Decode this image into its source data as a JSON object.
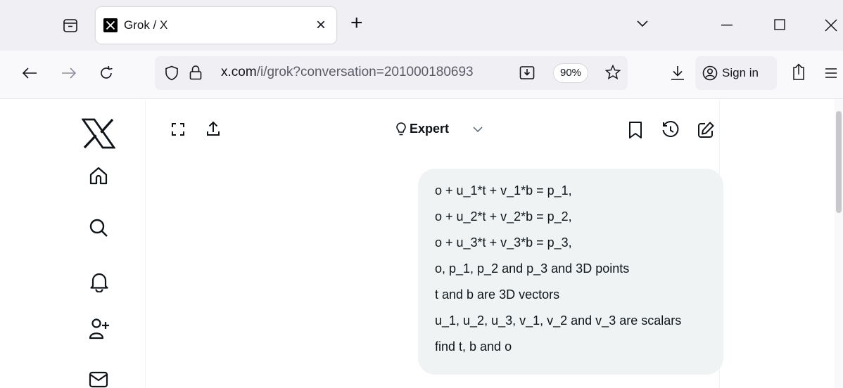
{
  "browser": {
    "tab": {
      "title": "Grok / X",
      "close": "×"
    },
    "new_tab": "+",
    "tab_list": "⌄",
    "window": {
      "minimize": "—",
      "maximize": "☐",
      "close": "✕"
    },
    "url": {
      "host": "x.com",
      "path": "/i/grok?conversation=201000180693",
      "zoom": "90%"
    },
    "sign_in": "Sign in"
  },
  "sidebar": {
    "items": [
      "x-logo",
      "home",
      "explore",
      "notifications",
      "follow",
      "messages"
    ]
  },
  "header": {
    "mode_label": "Expert"
  },
  "message": {
    "lines": [
      "o + u_1*t + v_1*b = p_1,",
      "o + u_2*t + v_2*b = p_2,",
      "o + u_3*t + v_3*b = p_3,",
      "o, p_1, p_2 and p_3 and 3D points",
      "t and b are 3D vectors",
      "u_1, u_2, u_3, v_1, v_2 and v_3 are scalars",
      "find t, b and o"
    ]
  }
}
